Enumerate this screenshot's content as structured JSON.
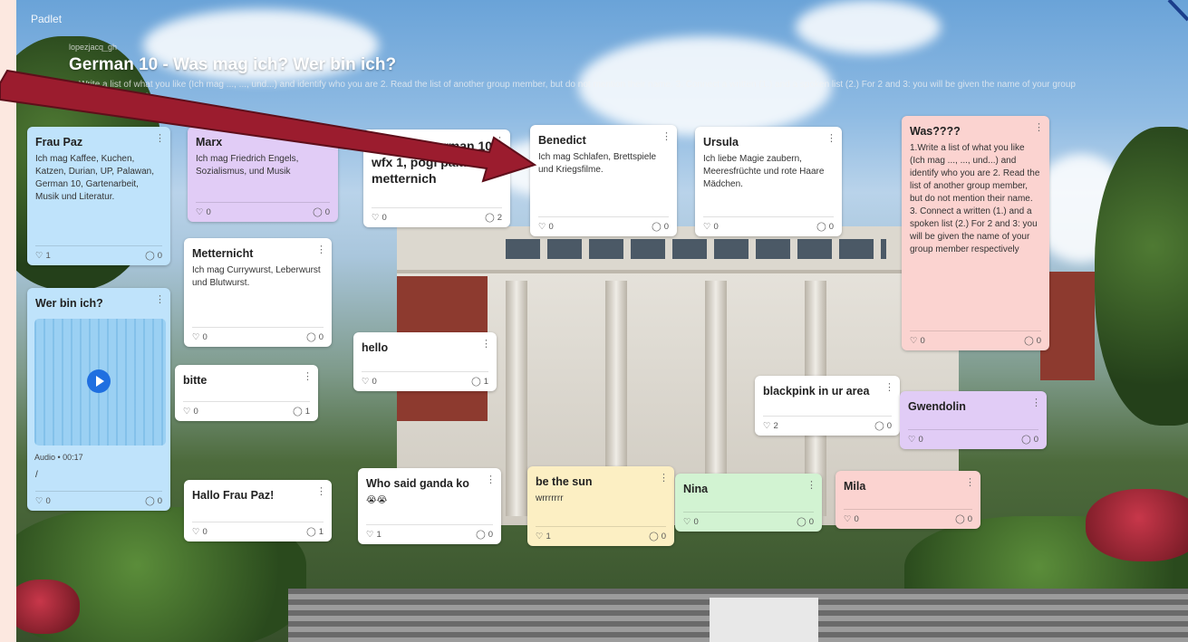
{
  "app": {
    "name": "Padlet",
    "breadcrumb": "lopezjacq_gh"
  },
  "board": {
    "title": "German 10 - Was mag ich? Wer bin ich?",
    "subtitle": "1. Write a list of what you like (Ich mag ..., ..., und...) and identify who you are 2. Read the list of another group member, but do not mention their name. 3. Connect a written (1.) and a spoken list (2.) For 2 and 3: you will be given the name of your group member respectively"
  },
  "cards": {
    "frau_paz": {
      "title": "Frau Paz",
      "body": "Ich mag Kaffee, Kuchen, Katzen, Durian, UP, Palawan, German 10, Gartenarbeit, Musik und Literatur.",
      "likes": "1",
      "comments": "0"
    },
    "wer_bin_ich": {
      "title": "Wer bin ich?",
      "audio": "Audio • 00:17",
      "body": "/",
      "likes": "0",
      "comments": "0"
    },
    "marx": {
      "title": "Marx",
      "body": "Ich mag Friedrich Engels, Sozialismus, und Musik",
      "likes": "0",
      "comments": "0"
    },
    "metternicht": {
      "title": "Metternicht",
      "body": "Ich mag Currywurst, Leberwurst und Blutwurst.",
      "likes": "0",
      "comments": "0"
    },
    "bitte": {
      "title": "bitte",
      "likes": "0",
      "comments": "1"
    },
    "hallo_frau_paz": {
      "title": "Hallo Frau Paz!",
      "likes": "0",
      "comments": "1"
    },
    "ganda": {
      "title": "Ganda ... german 10 wfx 1, pogi pala si metternich",
      "likes": "0",
      "comments": "2"
    },
    "hello": {
      "title": "hello",
      "likes": "0",
      "comments": "1"
    },
    "who_said": {
      "title": "Who said ganda ko",
      "body": "😭😭",
      "likes": "1",
      "comments": "0"
    },
    "benedict": {
      "title": "Benedict",
      "body": "Ich mag Schlafen, Brettspiele und Kriegsfilme.",
      "likes": "0",
      "comments": "0"
    },
    "be_the_sun": {
      "title": "be the sun",
      "body": "wrrrrrrr",
      "likes": "1",
      "comments": "0"
    },
    "ursula": {
      "title": "Ursula",
      "body": "Ich liebe Magie zaubern, Meeresfrüchte und rote Haare Mädchen.",
      "likes": "0",
      "comments": "0"
    },
    "nina": {
      "title": "Nina",
      "likes": "0",
      "comments": "0"
    },
    "blackpink": {
      "title": "blackpink in ur area",
      "likes": "2",
      "comments": "0"
    },
    "mila": {
      "title": "Mila",
      "likes": "0",
      "comments": "0"
    },
    "was": {
      "title": "Was????",
      "body": "1.Write a list of what you like (Ich mag ..., ..., und...) and identify who you are 2. Read the list of another group member, but do not mention their name. 3. Connect a written (1.) and a spoken list (2.) For 2 and 3: you will be given the name of your group member respectively",
      "likes": "0",
      "comments": "0"
    },
    "gwendolin": {
      "title": "Gwendolin",
      "likes": "0",
      "comments": "0"
    }
  },
  "icons": {
    "like": "heart-icon",
    "comment": "comment-icon",
    "menu": "kebab-menu-icon",
    "play": "play-icon"
  },
  "colors": {
    "arrow": "#9b1c2e",
    "blue": "#bfe3fb",
    "purple": "#e1ccf6",
    "pink": "#fbd3d0",
    "yellow": "#fcefc3",
    "green": "#d2f3d2"
  }
}
